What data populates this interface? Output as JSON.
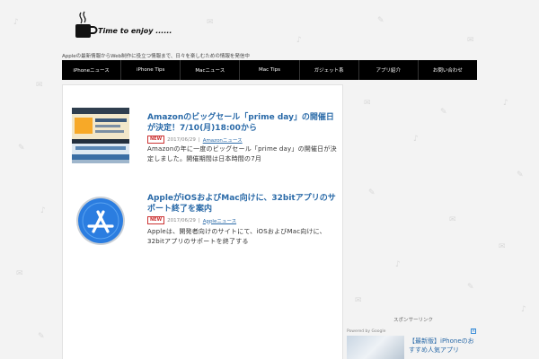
{
  "header": {
    "logo_text": "Time to enjoy ......",
    "tagline": "Appleの最新情報からWeb制作に役立つ情報まで、日々を楽しむための情報を発信中"
  },
  "nav": {
    "items": [
      {
        "label": "iPhoneニュース"
      },
      {
        "label": "iPhone Tips"
      },
      {
        "label": "Macニュース"
      },
      {
        "label": "Mac Tips"
      },
      {
        "label": "ガジェット系"
      },
      {
        "label": "アプリ紹介"
      },
      {
        "label": "お問い合わせ"
      }
    ]
  },
  "posts": [
    {
      "title": "Amazonのビッグセール「prime day」の開催日が決定！7/10(月)18:00から",
      "badge": "NEW",
      "date": "2017/06/29",
      "separator": "|",
      "category": "Amazonニュース",
      "excerpt": "Amazonの年に一度のビッグセール「prime day」の開催日が決定しました。開催期間は日本時間の7月"
    },
    {
      "title": "AppleがiOSおよびMac向けに、32bitアプリのサポート終了を案内",
      "badge": "NEW",
      "date": "2017/06/29",
      "separator": "|",
      "category": "Appleニュース",
      "excerpt": "Appleは、開発者向けのサイトにて、iOSおよびMac向けに、32bitアプリのサポートを終了する"
    }
  ],
  "sidebar": {
    "heading": "スポンサーリンク",
    "powered_by": "Powered by Google",
    "ad_close": "×",
    "ad_title": "【最新版】iPhoneのおすすめ人気アプリ"
  },
  "colors": {
    "link": "#2a6aa8",
    "nav_bg": "#000000",
    "badge": "#cc3333",
    "app_store_blue": "#2b7de0"
  }
}
